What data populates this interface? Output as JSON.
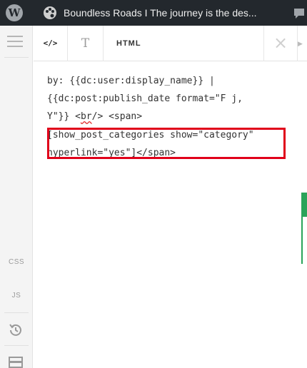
{
  "admin_bar": {
    "wp_logo_glyph": "W",
    "site_icon": "palette-icon",
    "site_title": "Boundless Roads I The journey is the des...",
    "comment_icon": "comment-icon"
  },
  "rail": {
    "menu_icon": "hamburger-icon",
    "css_label": "CSS",
    "js_label": "JS",
    "history_icon": "history-icon",
    "bottom_icon": "layout-icon"
  },
  "tabs": {
    "code_label": "</>",
    "text_label": "T",
    "html_label": "HTML",
    "close_label": "×",
    "play_label": "▶"
  },
  "code_lines": [
    "by: {{dc:user:display_name}} |",
    "{{dc:post:publish_date format=\"F j,",
    "Y\"}} <br/> <span>",
    "[show_post_categories show=\"category\"",
    "hyperlink=\"yes\"]</span>"
  ],
  "code_line3_parts": [
    "Y\"}} <",
    "br",
    "/> <span>"
  ]
}
